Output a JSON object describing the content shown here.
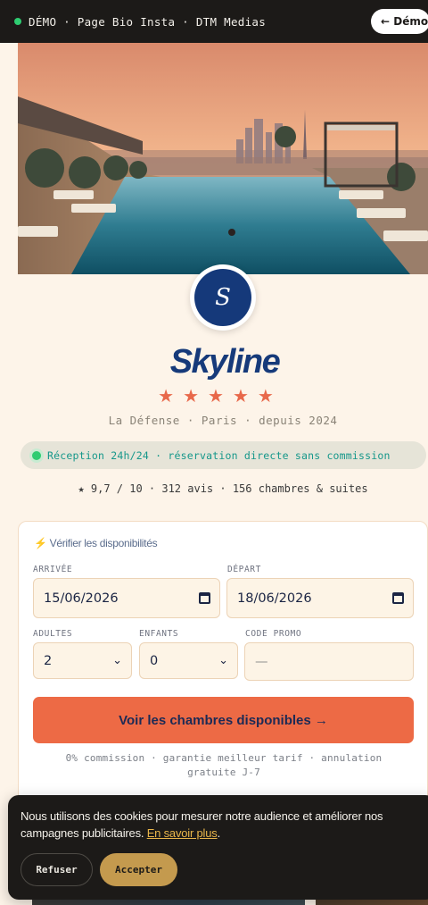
{
  "topbar": {
    "brand": "DÉMO · Page Bio Insta · DTM Medias",
    "demo_button": "← Démo"
  },
  "hero": {
    "alt": "Rooftop pool overlooking Paris skyline at sunset"
  },
  "logo": {
    "initial": "S"
  },
  "hotel": {
    "name": "Skyline",
    "stars": "★★★★★",
    "location": "La Défense · Paris · depuis 2024"
  },
  "reception": "Réception 24h/24 · réservation directe sans commission",
  "stats": "★ 9,7 / 10 · 312 avis  · 156 chambres & suites",
  "booking": {
    "title_icon": "⚡",
    "title": "Vérifier les disponibilités",
    "arrival_label": "ARRIVÉE",
    "arrival_value": "15/06/2026",
    "departure_label": "DÉPART",
    "departure_value": "18/06/2026",
    "adults_label": "ADULTES",
    "adults_value": "2",
    "children_label": "ENFANTS",
    "children_value": "0",
    "promo_label": "CODE PROMO",
    "promo_placeholder": "—",
    "cta": "Voir les chambres disponibles →",
    "note": "0% commission · garantie meilleur tarif · annulation gratuite J-7"
  },
  "cookie": {
    "message": "Nous utilisons des cookies pour mesurer notre audience et améliorer nos campagnes publicitaires.",
    "link": "En savoir plus",
    "after_link": ".",
    "refuse": "Refuser",
    "accept": "Accepter"
  },
  "colors": {
    "accent": "#ed6a45",
    "brand_navy": "#163a7a",
    "gold": "#c49a4e",
    "online_green": "#2ecc71"
  }
}
